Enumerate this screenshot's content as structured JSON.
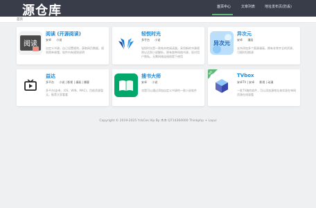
{
  "header": {
    "logo": "源仓库",
    "nav": [
      "首页中心",
      "文章列表",
      "地址发布页(防丢)"
    ]
  },
  "breadcrumb": "首页",
  "cards": [
    {
      "title": "阅读 (开源阅读)",
      "tags": [
        "安卓",
        "小说"
      ],
      "desc": "自定义书源，自己设置规则，获取网页数据，规则简单易懂，软件内有规则说明",
      "icon": "legado-book-icon",
      "icon_text": "阅读"
    },
    {
      "title": "轻悦时光",
      "tags": [
        "多平台",
        "小说"
      ],
      "desc": "轻悦时光是一款纯本地阅读器，采用新的书源规则以达到小说解析，原有各种网络书源，现对用户隐私，无需网络连接前提下使用",
      "icon": "wing-logo-icon"
    },
    {
      "title": "异次元",
      "tags": [
        "安卓",
        "漫画"
      ],
      "desc": "支持添加多个图源漫画，拥有非常齐全的资源，可随时切换源",
      "icon": "yiciyuan-icon",
      "icon_text": "异次元"
    },
    {
      "title": "益达",
      "tags": [
        "多平台",
        "小说 | 影视 | 漫画 | 播客"
      ],
      "desc": "多平台(安卓、iOS、WIN、MAC)，目前资源暂无，推荐大家看看",
      "icon": "tv-play-icon"
    },
    {
      "title": "搜书大师",
      "tags": [
        "安卓",
        "小说"
      ],
      "desc": "也是可以通过添加自定义书源的一款小说软件",
      "icon": "open-book-icon"
    },
    {
      "title": "TVbox",
      "tags": [
        "安卓TV | 安卓",
        "影视 | 动漫"
      ],
      "desc": "一款TV端的软件，可以添加源地址来实现在单网资源在线观看",
      "icon": "tvbox-cube-icon",
      "badge": "推荐"
    }
  ],
  "footer": "Copyright © 2019-2025 YckCes.Vip    By 木木 Q714364000 Thinkphp + Layui",
  "colors": {
    "topbar": "#393d49",
    "accent_green": "#5fb878",
    "title_blue": "#1e88d6"
  }
}
